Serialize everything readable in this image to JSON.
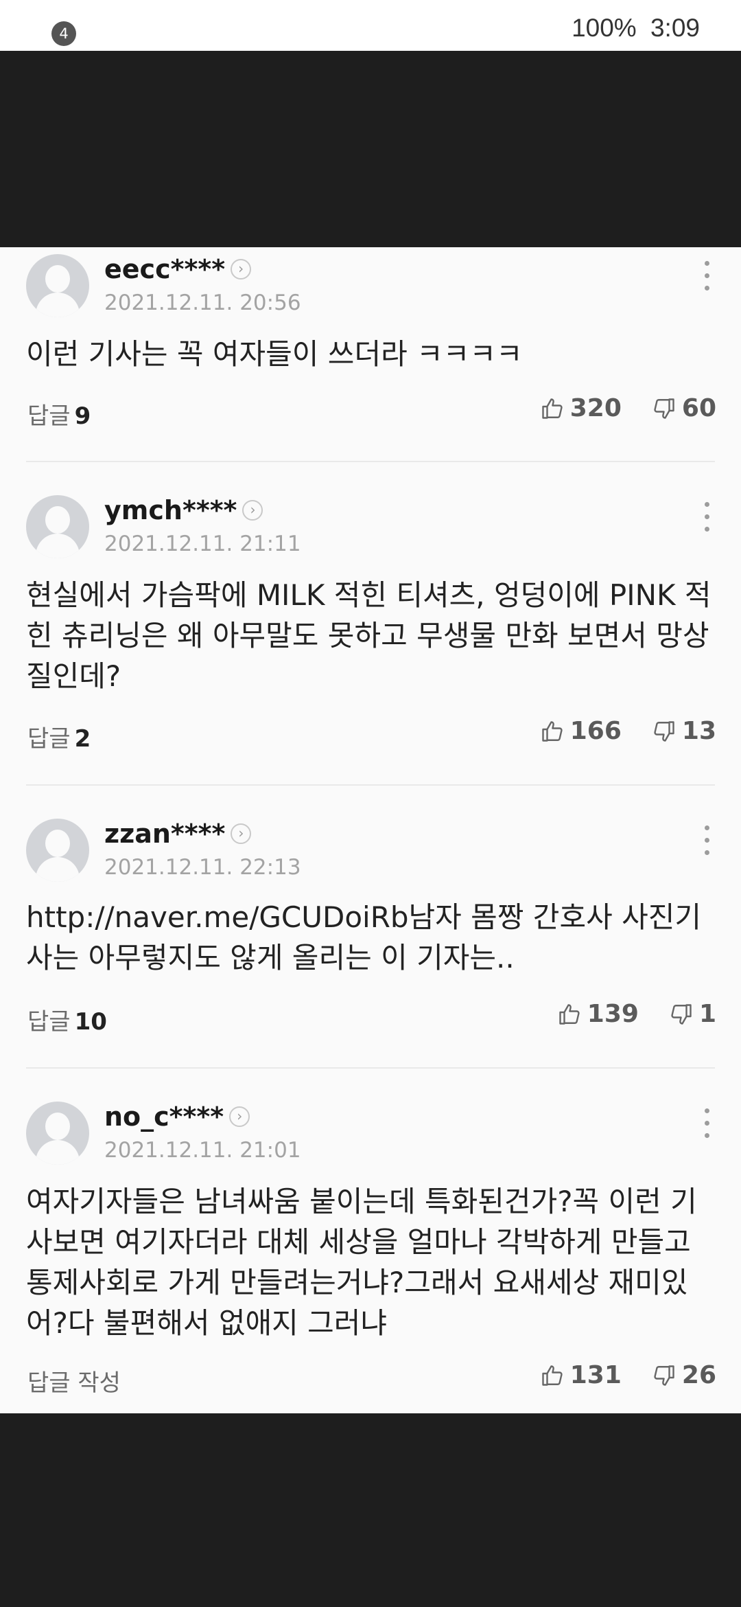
{
  "status_bar": {
    "notification_count": "4",
    "battery": "100%",
    "time": "3:09"
  },
  "comments": [
    {
      "username": "eecc****",
      "date": "2021.12.11. 20:56",
      "text": "이런 기사는 꼭 여자들이 쓰더라 ㅋㅋㅋㅋ",
      "reply_label": "답글",
      "reply_count": "9",
      "likes": "320",
      "dislikes": "60"
    },
    {
      "username": "ymch****",
      "date": "2021.12.11. 21:11",
      "text": "현실에서 가슴팍에 MILK 적힌 티셔츠, 엉덩이에 PINK 적힌 츄리닝은 왜 아무말도 못하고 무생물 만화 보면서 망상질인데?",
      "reply_label": "답글",
      "reply_count": "2",
      "likes": "166",
      "dislikes": "13"
    },
    {
      "username": "zzan****",
      "date": "2021.12.11. 22:13",
      "text": "http://naver.me/GCUDoiRb남자 몸짱 간호사 사진기사는 아무렇지도 않게 올리는 이 기자는..",
      "reply_label": "답글",
      "reply_count": "10",
      "likes": "139",
      "dislikes": "1"
    },
    {
      "username": "no_c****",
      "date": "2021.12.11. 21:01",
      "text": "여자기자들은 남녀싸움 붙이는데 특화된건가?꼭 이런 기사보면 여기자더라 대체 세상을 얼마나 각박하게 만들고 통제사회로 가게 만들려는거냐?그래서 요새세상 재미있어?다 불편해서 없애지 그러냐",
      "reply_label": "답글 작성",
      "reply_count": "",
      "likes": "131",
      "dislikes": "26"
    }
  ],
  "colors": {
    "background_dark": "#1e1e1e",
    "card_background": "#fafafa",
    "date_text": "#a3a3a3"
  },
  "icons": {
    "like": "thumbs-up-icon",
    "dislike": "thumbs-down-icon",
    "more": "kebab-menu-icon",
    "profile": "chevron-right-icon"
  }
}
